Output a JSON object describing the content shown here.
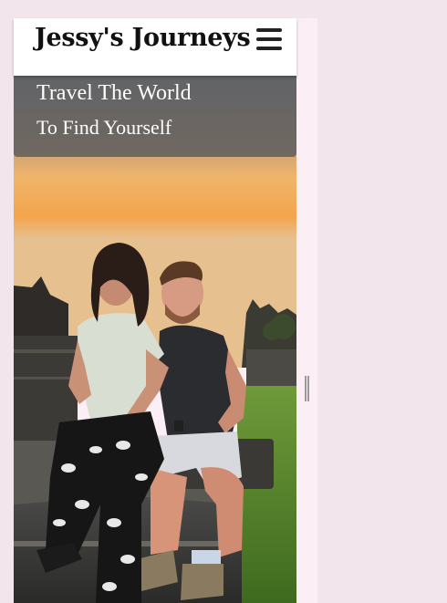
{
  "header": {
    "site_title": "Jessy's Journeys",
    "menu_icon": "hamburger-menu-icon"
  },
  "hero": {
    "line_1": "Travel The World",
    "line_2": "To Find Yourself",
    "photo": "couple-sitting-on-temple-steps-at-sunset"
  },
  "colors": {
    "page_background": "#f2e5ec",
    "header_background": "#ffffff",
    "banner_overlay": "#62605e",
    "banner_text": "#ffffff",
    "title_text": "#111111"
  },
  "viewport_handle": {
    "icon": "resize-grip-icon"
  }
}
